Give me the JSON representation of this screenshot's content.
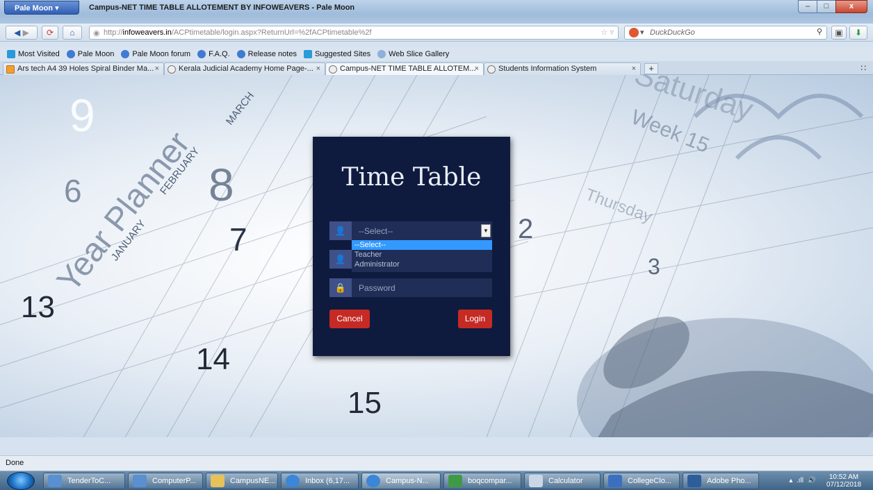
{
  "browser": {
    "menu_button": "Pale Moon",
    "window_title": "Campus-NET TIME TABLE ALLOTEMENT BY INFOWEAVERS - Pale Moon",
    "url_prefix": "http://",
    "url_domain": "infoweavers.in",
    "url_path": "/ACPtimetable/login.aspx?ReturnUrl=%2fACPtimetable%2f",
    "search_engine": "DuckDuckGo",
    "window_controls": {
      "minimize": "–",
      "maximize": "□",
      "close": "x"
    }
  },
  "bookmarks": [
    "Most Visited",
    "Pale Moon",
    "Pale Moon forum",
    "F.A.Q.",
    "Release notes",
    "Suggested Sites",
    "Web Slice Gallery"
  ],
  "tabs": [
    {
      "label": "Ars tech A4 39 Holes Spiral Binder Ma..."
    },
    {
      "label": "Kerala Judicial Academy Home Page-..."
    },
    {
      "label": "Campus-NET TIME TABLE ALLOTEM..."
    },
    {
      "label": "Students Information System"
    }
  ],
  "background_words": {
    "year_planner": "Year Planner",
    "months": [
      "JANUARY",
      "FEBRUARY",
      "MARCH"
    ],
    "numbers": [
      "13",
      "14",
      "15",
      "6",
      "7",
      "8",
      "9",
      "2",
      "3"
    ],
    "misc": [
      "Week 15",
      "Thursday",
      "Saturday"
    ]
  },
  "login": {
    "title": "Time Table",
    "role_select_value": "--Select--",
    "role_options": [
      "--Select--",
      "Teacher",
      "Administrator"
    ],
    "password_placeholder": "Password",
    "cancel_label": "Cancel",
    "login_label": "Login"
  },
  "status": {
    "text": "Done"
  },
  "taskbar": {
    "items": [
      "TenderToC...",
      "ComputerP...",
      "CampusNE...",
      "Inbox (6,17...",
      "Campus-N...",
      "boqcompar...",
      "Calculator",
      "CollegeClo...",
      "Adobe Pho..."
    ],
    "time": "10:52 AM",
    "date": "07/12/2018"
  },
  "colors": {
    "card_bg": "#0f1b3e",
    "button_red": "#c62a24",
    "select_highlight": "#3399ff",
    "icon_box": "#3f5188"
  }
}
